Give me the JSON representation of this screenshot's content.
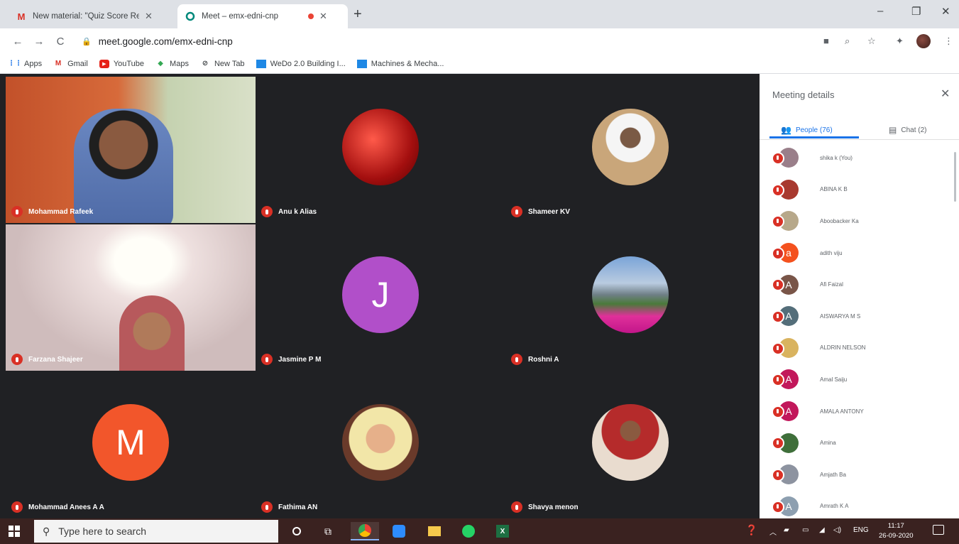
{
  "browser": {
    "tabs": [
      {
        "icon": "gmail-icon",
        "title": "New material: \"Quiz Score Relea",
        "close": "✕"
      },
      {
        "icon": "meet-icon",
        "title": "Meet – emx-edni-cnp",
        "close": "✕"
      }
    ],
    "new_tab": "+",
    "window": {
      "minimize": "–",
      "restore": "❐",
      "close": "✕"
    },
    "nav": {
      "back": "←",
      "forward": "→",
      "reload": "C"
    },
    "url": "meet.google.com/emx-edni-cnp",
    "bookmarks": [
      {
        "icon": "apps-grid-icon",
        "label": "Apps"
      },
      {
        "icon": "gmail-icon",
        "label": "Gmail"
      },
      {
        "icon": "youtube-icon",
        "label": "YouTube"
      },
      {
        "icon": "maps-icon",
        "label": "Maps"
      },
      {
        "icon": "new-tab-icon",
        "label": "New Tab"
      },
      {
        "icon": "bookmark-page-icon",
        "label": "WeDo 2.0 Building I..."
      },
      {
        "icon": "bookmark-page-icon",
        "label": "Machines & Mecha..."
      }
    ]
  },
  "meeting": {
    "tiles": [
      {
        "name": "Mohammad Rafeek",
        "kind": "video"
      },
      {
        "name": "Anu k Alias",
        "kind": "photo"
      },
      {
        "name": "Shameer KV",
        "kind": "photo"
      },
      {
        "name": "Farzana Shajeer",
        "kind": "video"
      },
      {
        "name": "Jasmine P M",
        "kind": "initial",
        "initial": "J",
        "color": "#b14fc9"
      },
      {
        "name": "Roshni A",
        "kind": "photo"
      },
      {
        "name": "Mohammad Anees A A",
        "kind": "initial",
        "initial": "M",
        "color": "#f2562b"
      },
      {
        "name": "Fathima AN",
        "kind": "photo"
      },
      {
        "name": "Shavya menon",
        "kind": "photo"
      }
    ]
  },
  "sidebar": {
    "title": "Meeting details",
    "close": "✕",
    "tab_people": "People (76)",
    "tab_chat": "Chat (2)",
    "people": [
      {
        "name": "shika k (You)",
        "initial": "",
        "color": "#9a7f8a"
      },
      {
        "name": "ABINA K B",
        "initial": "",
        "color": "#a8392f"
      },
      {
        "name": "Aboobacker Ka",
        "initial": "",
        "color": "#b7a88a"
      },
      {
        "name": "adith viju",
        "initial": "a",
        "color": "#f4511e"
      },
      {
        "name": "Afi Faizal",
        "initial": "A",
        "color": "#795548"
      },
      {
        "name": "AISWARYA M S",
        "initial": "A",
        "color": "#546e7a"
      },
      {
        "name": "ALDRIN NELSON",
        "initial": "",
        "color": "#d9b35f"
      },
      {
        "name": "Amal Saiju",
        "initial": "A",
        "color": "#c2185b"
      },
      {
        "name": "AMALA ANTONY",
        "initial": "A",
        "color": "#c2185b"
      },
      {
        "name": "Amina",
        "initial": "",
        "color": "#3f6f3a"
      },
      {
        "name": "Amjath Ba",
        "initial": "",
        "color": "#8d93a0"
      },
      {
        "name": "Amrath K A",
        "initial": "A",
        "color": "#8d9fb0"
      }
    ]
  },
  "taskbar": {
    "search_placeholder": "Type here to search",
    "time": "11:17",
    "date": "26-09-2020",
    "lang": "ENG"
  }
}
